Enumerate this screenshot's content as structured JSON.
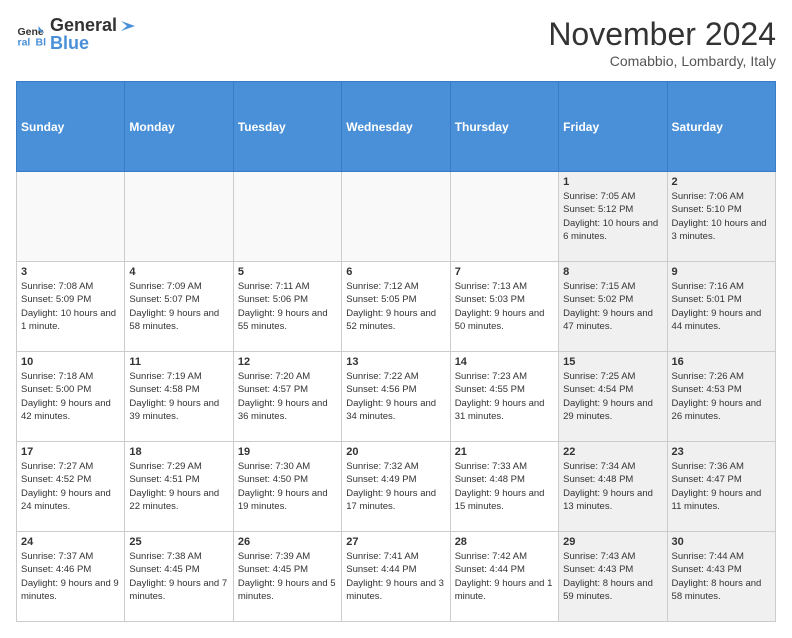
{
  "logo": {
    "line1": "General",
    "line2": "Blue"
  },
  "title": "November 2024",
  "subtitle": "Comabbio, Lombardy, Italy",
  "headers": [
    "Sunday",
    "Monday",
    "Tuesday",
    "Wednesday",
    "Thursday",
    "Friday",
    "Saturday"
  ],
  "weeks": [
    [
      {
        "day": "",
        "info": "",
        "empty": true
      },
      {
        "day": "",
        "info": "",
        "empty": true
      },
      {
        "day": "",
        "info": "",
        "empty": true
      },
      {
        "day": "",
        "info": "",
        "empty": true
      },
      {
        "day": "",
        "info": "",
        "empty": true
      },
      {
        "day": "1",
        "info": "Sunrise: 7:05 AM\nSunset: 5:12 PM\nDaylight: 10 hours and 6 minutes.",
        "shaded": true
      },
      {
        "day": "2",
        "info": "Sunrise: 7:06 AM\nSunset: 5:10 PM\nDaylight: 10 hours and 3 minutes.",
        "shaded": true
      }
    ],
    [
      {
        "day": "3",
        "info": "Sunrise: 7:08 AM\nSunset: 5:09 PM\nDaylight: 10 hours and 1 minute."
      },
      {
        "day": "4",
        "info": "Sunrise: 7:09 AM\nSunset: 5:07 PM\nDaylight: 9 hours and 58 minutes."
      },
      {
        "day": "5",
        "info": "Sunrise: 7:11 AM\nSunset: 5:06 PM\nDaylight: 9 hours and 55 minutes."
      },
      {
        "day": "6",
        "info": "Sunrise: 7:12 AM\nSunset: 5:05 PM\nDaylight: 9 hours and 52 minutes."
      },
      {
        "day": "7",
        "info": "Sunrise: 7:13 AM\nSunset: 5:03 PM\nDaylight: 9 hours and 50 minutes."
      },
      {
        "day": "8",
        "info": "Sunrise: 7:15 AM\nSunset: 5:02 PM\nDaylight: 9 hours and 47 minutes.",
        "shaded": true
      },
      {
        "day": "9",
        "info": "Sunrise: 7:16 AM\nSunset: 5:01 PM\nDaylight: 9 hours and 44 minutes.",
        "shaded": true
      }
    ],
    [
      {
        "day": "10",
        "info": "Sunrise: 7:18 AM\nSunset: 5:00 PM\nDaylight: 9 hours and 42 minutes."
      },
      {
        "day": "11",
        "info": "Sunrise: 7:19 AM\nSunset: 4:58 PM\nDaylight: 9 hours and 39 minutes."
      },
      {
        "day": "12",
        "info": "Sunrise: 7:20 AM\nSunset: 4:57 PM\nDaylight: 9 hours and 36 minutes."
      },
      {
        "day": "13",
        "info": "Sunrise: 7:22 AM\nSunset: 4:56 PM\nDaylight: 9 hours and 34 minutes."
      },
      {
        "day": "14",
        "info": "Sunrise: 7:23 AM\nSunset: 4:55 PM\nDaylight: 9 hours and 31 minutes."
      },
      {
        "day": "15",
        "info": "Sunrise: 7:25 AM\nSunset: 4:54 PM\nDaylight: 9 hours and 29 minutes.",
        "shaded": true
      },
      {
        "day": "16",
        "info": "Sunrise: 7:26 AM\nSunset: 4:53 PM\nDaylight: 9 hours and 26 minutes.",
        "shaded": true
      }
    ],
    [
      {
        "day": "17",
        "info": "Sunrise: 7:27 AM\nSunset: 4:52 PM\nDaylight: 9 hours and 24 minutes."
      },
      {
        "day": "18",
        "info": "Sunrise: 7:29 AM\nSunset: 4:51 PM\nDaylight: 9 hours and 22 minutes."
      },
      {
        "day": "19",
        "info": "Sunrise: 7:30 AM\nSunset: 4:50 PM\nDaylight: 9 hours and 19 minutes."
      },
      {
        "day": "20",
        "info": "Sunrise: 7:32 AM\nSunset: 4:49 PM\nDaylight: 9 hours and 17 minutes."
      },
      {
        "day": "21",
        "info": "Sunrise: 7:33 AM\nSunset: 4:48 PM\nDaylight: 9 hours and 15 minutes."
      },
      {
        "day": "22",
        "info": "Sunrise: 7:34 AM\nSunset: 4:48 PM\nDaylight: 9 hours and 13 minutes.",
        "shaded": true
      },
      {
        "day": "23",
        "info": "Sunrise: 7:36 AM\nSunset: 4:47 PM\nDaylight: 9 hours and 11 minutes.",
        "shaded": true
      }
    ],
    [
      {
        "day": "24",
        "info": "Sunrise: 7:37 AM\nSunset: 4:46 PM\nDaylight: 9 hours and 9 minutes."
      },
      {
        "day": "25",
        "info": "Sunrise: 7:38 AM\nSunset: 4:45 PM\nDaylight: 9 hours and 7 minutes."
      },
      {
        "day": "26",
        "info": "Sunrise: 7:39 AM\nSunset: 4:45 PM\nDaylight: 9 hours and 5 minutes."
      },
      {
        "day": "27",
        "info": "Sunrise: 7:41 AM\nSunset: 4:44 PM\nDaylight: 9 hours and 3 minutes."
      },
      {
        "day": "28",
        "info": "Sunrise: 7:42 AM\nSunset: 4:44 PM\nDaylight: 9 hours and 1 minute."
      },
      {
        "day": "29",
        "info": "Sunrise: 7:43 AM\nSunset: 4:43 PM\nDaylight: 8 hours and 59 minutes.",
        "shaded": true
      },
      {
        "day": "30",
        "info": "Sunrise: 7:44 AM\nSunset: 4:43 PM\nDaylight: 8 hours and 58 minutes.",
        "shaded": true
      }
    ]
  ]
}
